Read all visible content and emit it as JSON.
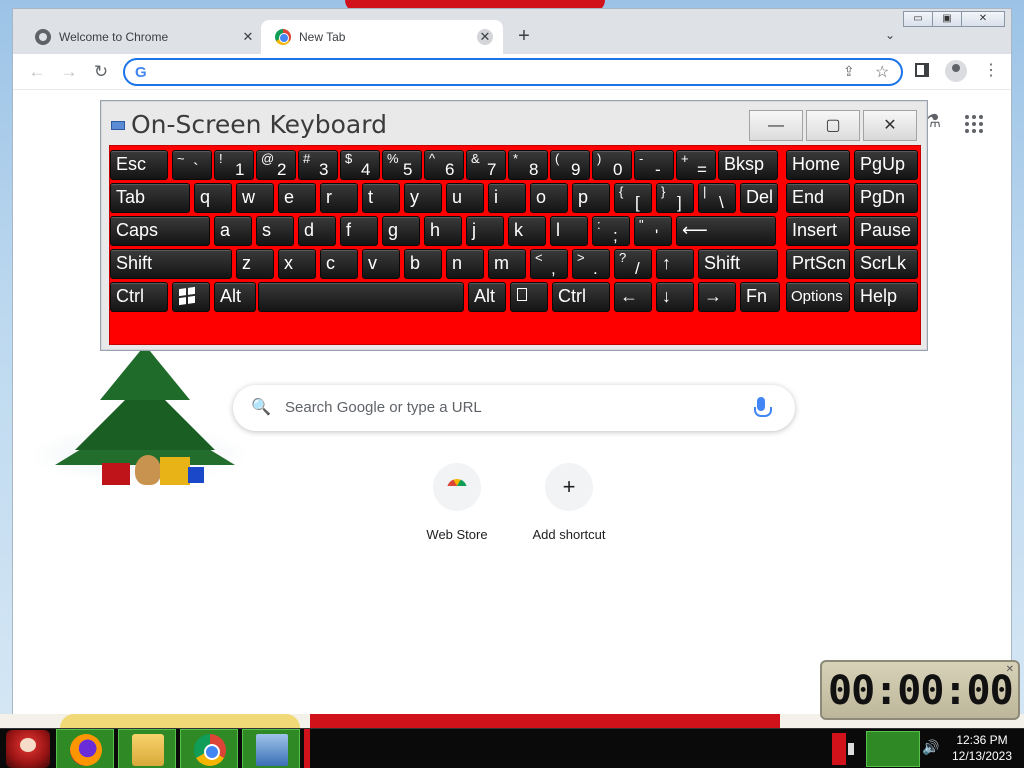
{
  "browser": {
    "tabs": [
      {
        "title": "Welcome to Chrome",
        "close": "✕",
        "active": false
      },
      {
        "title": "New Tab",
        "close": "✕",
        "active": true
      }
    ],
    "new_tab_label": "+",
    "tab_search_icon": "chevron-down-icon",
    "window_controls": {
      "minimize": "▭",
      "maximize": "▣",
      "close": "✕"
    },
    "toolbar": {
      "back": "←",
      "forward": "→",
      "reload": "↻",
      "omnibox_value": "",
      "omnibox_logo": "G",
      "share": "⇪",
      "star": "☆",
      "menu": "⋮"
    },
    "ntp": {
      "search_placeholder": "Search Google or type a URL",
      "search_icon": "🔍",
      "shortcuts": [
        {
          "label": "Web Store",
          "icon": "web-store-icon"
        },
        {
          "label": "Add shortcut",
          "icon": "+"
        }
      ],
      "labs_icon": "⚗"
    }
  },
  "osk": {
    "title": "On-Screen Keyboard",
    "controls": {
      "minimize": "—",
      "maximize": "▢",
      "close": "✕"
    },
    "rows": [
      [
        {
          "t": "Esc"
        },
        {
          "s": "~",
          "m": "`"
        },
        {
          "s": "!",
          "m": "1"
        },
        {
          "s": "@",
          "m": "2"
        },
        {
          "s": "#",
          "m": "3"
        },
        {
          "s": "$",
          "m": "4"
        },
        {
          "s": "%",
          "m": "5"
        },
        {
          "s": "^",
          "m": "6"
        },
        {
          "s": "&",
          "m": "7"
        },
        {
          "s": "*",
          "m": "8"
        },
        {
          "s": "(",
          "m": "9"
        },
        {
          "s": ")",
          "m": "0"
        },
        {
          "s": "-",
          "m": "-"
        },
        {
          "s": "+",
          "m": "="
        },
        {
          "t": "Bksp"
        },
        {
          "t": "Home"
        },
        {
          "t": "PgUp"
        }
      ],
      [
        {
          "t": "Tab"
        },
        {
          "t": "q"
        },
        {
          "t": "w"
        },
        {
          "t": "e"
        },
        {
          "t": "r"
        },
        {
          "t": "t"
        },
        {
          "t": "y"
        },
        {
          "t": "u"
        },
        {
          "t": "i"
        },
        {
          "t": "o"
        },
        {
          "t": "p"
        },
        {
          "s": "{",
          "m": "["
        },
        {
          "s": "}",
          "m": "]"
        },
        {
          "s": "|",
          "m": "\\"
        },
        {
          "t": "Del"
        },
        {
          "t": "End"
        },
        {
          "t": "PgDn"
        }
      ],
      [
        {
          "t": "Caps"
        },
        {
          "t": "a"
        },
        {
          "t": "s"
        },
        {
          "t": "d"
        },
        {
          "t": "f"
        },
        {
          "t": "g"
        },
        {
          "t": "h"
        },
        {
          "t": "j"
        },
        {
          "t": "k"
        },
        {
          "t": "l"
        },
        {
          "s": ":",
          "m": ";"
        },
        {
          "s": "\"",
          "m": "'"
        },
        {
          "t": "⟵"
        },
        {
          "t": "Insert"
        },
        {
          "t": "Pause"
        }
      ],
      [
        {
          "t": "Shift"
        },
        {
          "t": "z"
        },
        {
          "t": "x"
        },
        {
          "t": "c"
        },
        {
          "t": "v"
        },
        {
          "t": "b"
        },
        {
          "t": "n"
        },
        {
          "t": "m"
        },
        {
          "s": "<",
          "m": ","
        },
        {
          "s": ">",
          "m": "."
        },
        {
          "s": "?",
          "m": "/"
        },
        {
          "t": "↑"
        },
        {
          "t": "Shift"
        },
        {
          "t": "PrtScn"
        },
        {
          "t": "ScrLk"
        }
      ],
      [
        {
          "t": "Ctrl"
        },
        {
          "t": "windows-key"
        },
        {
          "t": "Alt"
        },
        {
          "t": ""
        },
        {
          "t": "Alt"
        },
        {
          "t": "menu-key"
        },
        {
          "t": "Ctrl"
        },
        {
          "t": "←"
        },
        {
          "t": "↓"
        },
        {
          "t": "→"
        },
        {
          "t": "Fn"
        },
        {
          "t": "Options"
        },
        {
          "t": "Help"
        }
      ]
    ]
  },
  "timer": {
    "display": "00:00:00"
  },
  "taskbar": {
    "apps": [
      {
        "name": "firefox-icon"
      },
      {
        "name": "file-explorer-icon"
      },
      {
        "name": "chrome-icon"
      },
      {
        "name": "on-screen-keyboard-icon"
      }
    ],
    "clock_time": "12:36 PM",
    "clock_date": "12/13/2023",
    "volume_icon": "🔊"
  }
}
